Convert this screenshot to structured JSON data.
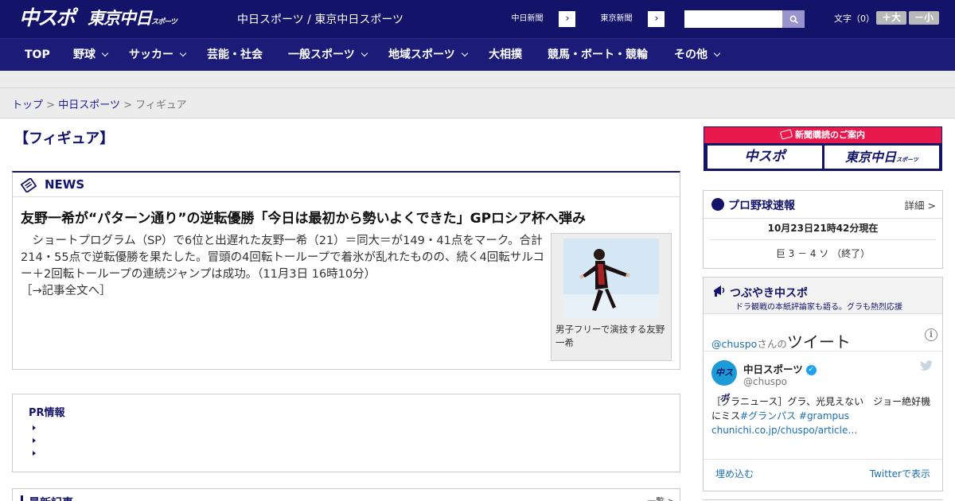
{
  "header": {
    "logo_chuspo": "中スポ",
    "logo_tokyo": "東京中日",
    "logo_tokyo_small": "スポーツ",
    "site_title": "中日スポーツ / 東京中日スポーツ",
    "ext_links": [
      {
        "label": "中日新聞",
        "arrow": "›"
      },
      {
        "label": "東京新聞",
        "arrow": "›"
      }
    ],
    "search": {
      "value": "",
      "placeholder": ""
    },
    "font_size_label": "文字（0）",
    "font_bigger": "＋大",
    "font_smaller": "－小"
  },
  "nav": {
    "items": [
      {
        "label": "TOP",
        "has_dropdown": false
      },
      {
        "label": "野球",
        "has_dropdown": true
      },
      {
        "label": "サッカー",
        "has_dropdown": true
      },
      {
        "label": "芸能・社会",
        "has_dropdown": false
      },
      {
        "label": "一般スポーツ",
        "has_dropdown": true
      },
      {
        "label": "地域スポーツ",
        "has_dropdown": true
      },
      {
        "label": "大相撲",
        "has_dropdown": false
      },
      {
        "label": "競馬・ボート・競輪",
        "has_dropdown": false
      },
      {
        "label": "その他",
        "has_dropdown": true
      }
    ]
  },
  "breadcrumb": {
    "items": [
      "トップ",
      "中日スポーツ"
    ],
    "separator": ">",
    "current": "フィギュア"
  },
  "page": {
    "heading": "【フィギュア】"
  },
  "news": {
    "section_label": "NEWS",
    "title": "友野一希が“パターン通り”の逆転優勝「今日は最初から勢いよくできた」GPロシア杯へ弾み",
    "body": "　ショートプログラム（SP）で6位と出遅れた友野一希（21）＝同大＝が149・41点をマーク。合計214・55点で逆転優勝を果たした。冒頭の4回転トーループで着氷が乱れたものの、続く4回転サルコー＋2回転トーループの連続ジャンプは成功。（11月3日 16時10分）",
    "more": "［→記事全文へ］",
    "photo_caption": "男子フリーで演技する友野一希"
  },
  "pr": {
    "title": "PR情報",
    "items": [
      "",
      "",
      ""
    ]
  },
  "latest": {
    "title": "最新記事",
    "more": "一覧 >"
  },
  "subscription": {
    "head": "新聞購読のご案内",
    "logos": [
      "中スポ",
      "東京中日"
    ],
    "tokyo_small": "スポーツ"
  },
  "baseball": {
    "title": "プロ野球速報",
    "detail": "詳細 >",
    "updated": "10月23日21時42分現在",
    "score": "巨  3  －  4  ソ  （終了）"
  },
  "tweets": {
    "title": "つぶやき中スポ",
    "subtitle": "ドラ観戦の本紙評論家も語る。グラも熱烈応援",
    "handle_prefix": "@chuspo",
    "handle_suffix": "さんの",
    "tweet_word": "ツイート",
    "info": "i",
    "avatar_text": "中スポ",
    "name": "中日スポーツ",
    "verified": "✓",
    "at": "@chuspo",
    "text_plain": "［グラニュース］グラ、光見えない　ジョー絶好機にミス",
    "text_tags": "#グランパス #grampus",
    "text_link": "chunichi.co.jp/chuspo/article…",
    "embed": "埋め込む",
    "view": "Twitterで表示"
  }
}
